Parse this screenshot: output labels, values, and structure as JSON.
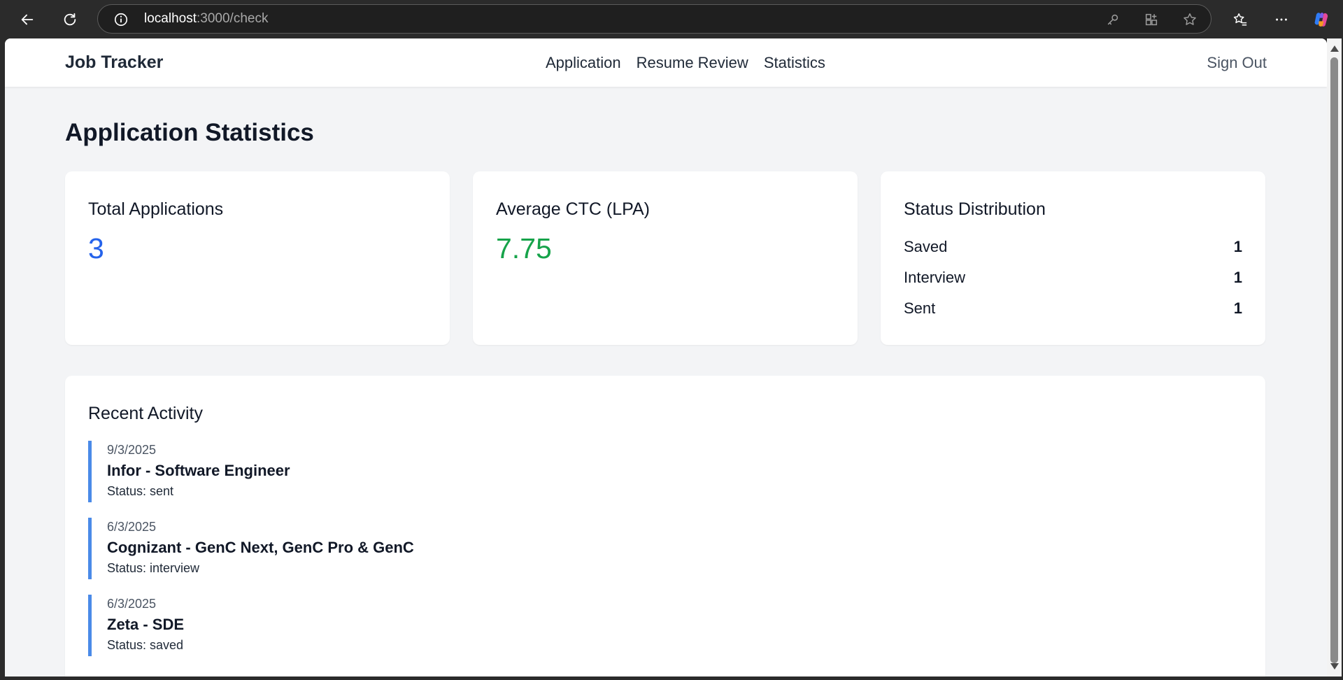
{
  "browser": {
    "url_host": "localhost",
    "url_path": ":3000/check"
  },
  "nav": {
    "brand": "Job Tracker",
    "links": [
      "Application",
      "Resume Review",
      "Statistics"
    ],
    "signout": "Sign Out"
  },
  "page": {
    "title": "Application Statistics"
  },
  "cards": {
    "total": {
      "title": "Total Applications",
      "value": "3",
      "color": "#2563eb"
    },
    "avg": {
      "title": "Average CTC (LPA)",
      "value": "7.75",
      "color": "#16a34a"
    },
    "status": {
      "title": "Status Distribution",
      "rows": [
        {
          "label": "Saved",
          "count": "1"
        },
        {
          "label": "Interview",
          "count": "1"
        },
        {
          "label": "Sent",
          "count": "1"
        }
      ]
    }
  },
  "activity": {
    "title": "Recent Activity",
    "accent": "#4a8ae8",
    "items": [
      {
        "date": "9/3/2025",
        "title": "Infor - Software Engineer",
        "status": "Status: sent"
      },
      {
        "date": "6/3/2025",
        "title": "Cognizant - GenC Next, GenC Pro & GenC",
        "status": "Status: interview"
      },
      {
        "date": "6/3/2025",
        "title": "Zeta - SDE",
        "status": "Status: saved"
      }
    ]
  }
}
